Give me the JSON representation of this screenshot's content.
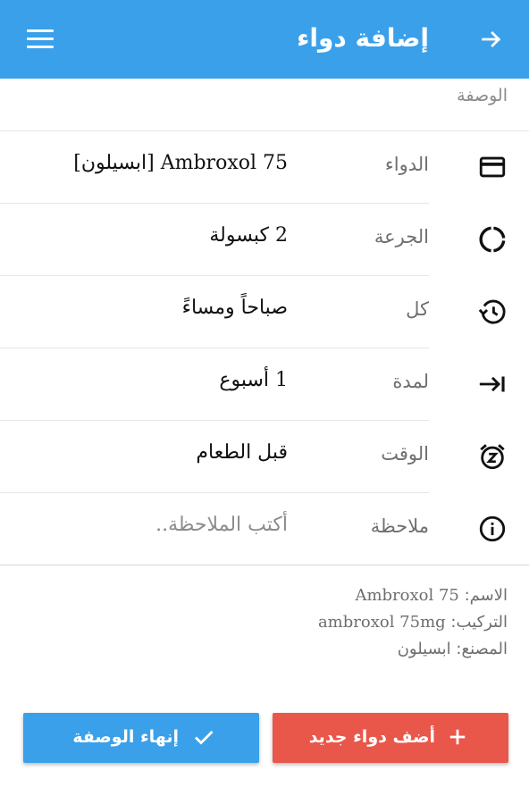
{
  "appbar": {
    "title": "إضافة دواء",
    "menu_icon": "menu-icon",
    "back_icon": "arrow-right-icon",
    "color": "#3aa0ea"
  },
  "section": {
    "label": "الوصفة"
  },
  "fields": [
    {
      "icon": "credit-card-icon",
      "label": "الدواء",
      "value": "Ambroxol 75 [ابسيلون]"
    },
    {
      "icon": "progress-circle-icon",
      "label": "الجرعة",
      "value": "2 كبسولة"
    },
    {
      "icon": "history-icon",
      "label": "كل",
      "value": "صباحاً ومساءً"
    },
    {
      "icon": "arrow-to-end-icon",
      "label": "لمدة",
      "value": "1 أسبوع"
    },
    {
      "icon": "alarm-snooze-icon",
      "label": "الوقت",
      "value": "قبل الطعام"
    },
    {
      "icon": "info-icon",
      "label": "ملاحظة",
      "placeholder": "أكتب الملاحظة.."
    }
  ],
  "info": {
    "name_label": "الاسم:",
    "name_value": "Ambroxol 75",
    "composition_label": "التركيب:",
    "composition_value": "ambroxol 75mg",
    "manufacturer_label": "المصنع:",
    "manufacturer_value": "ابسيلون"
  },
  "buttons": {
    "add_label": "أضف دواء جديد",
    "add_icon": "plus-icon",
    "add_color": "#e9574a",
    "finish_label": "إنهاء الوصفة",
    "finish_icon": "check-icon",
    "finish_color": "#3aa0ea"
  }
}
